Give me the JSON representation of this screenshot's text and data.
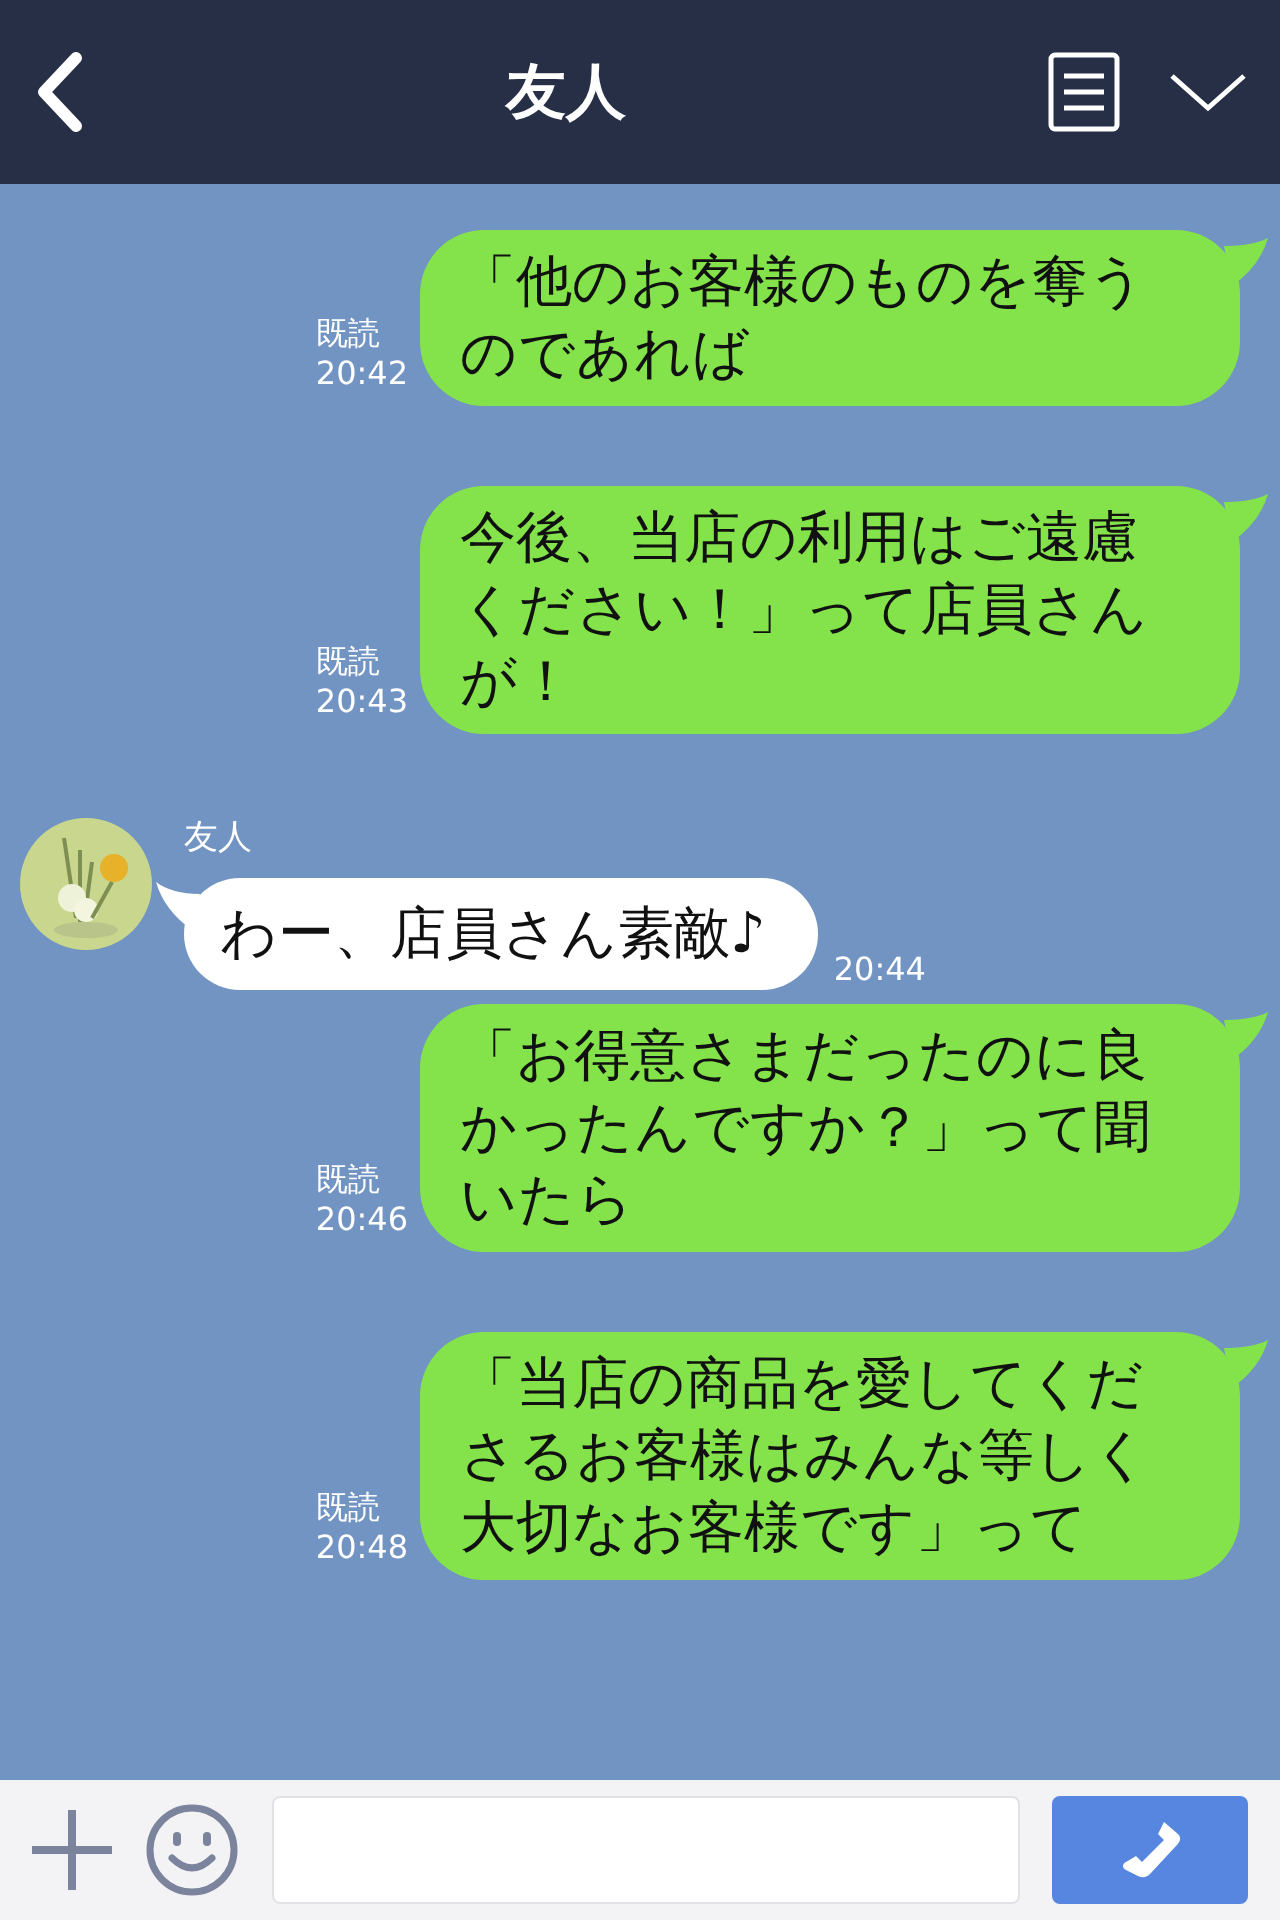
{
  "header": {
    "title": "友人"
  },
  "messages": [
    {
      "kind": "sent",
      "status": "既読",
      "time": "20:42",
      "text": "「他のお客様のものを奪うのであれば"
    },
    {
      "kind": "sent",
      "status": "既読",
      "time": "20:43",
      "text": "今後、当店の利用はご遠慮ください！」って店員さんが！"
    },
    {
      "kind": "received",
      "sender": "友人",
      "time": "20:44",
      "text": "わー、店員さん素敵♪"
    },
    {
      "kind": "sent",
      "status": "既読",
      "time": "20:46",
      "text": "「お得意さまだったのに良かったんですか？」って聞いたら"
    },
    {
      "kind": "sent",
      "status": "既読",
      "time": "20:48",
      "text": "「当店の商品を愛してくださるお客様はみんな等しく大切なお客様です」って"
    }
  ]
}
